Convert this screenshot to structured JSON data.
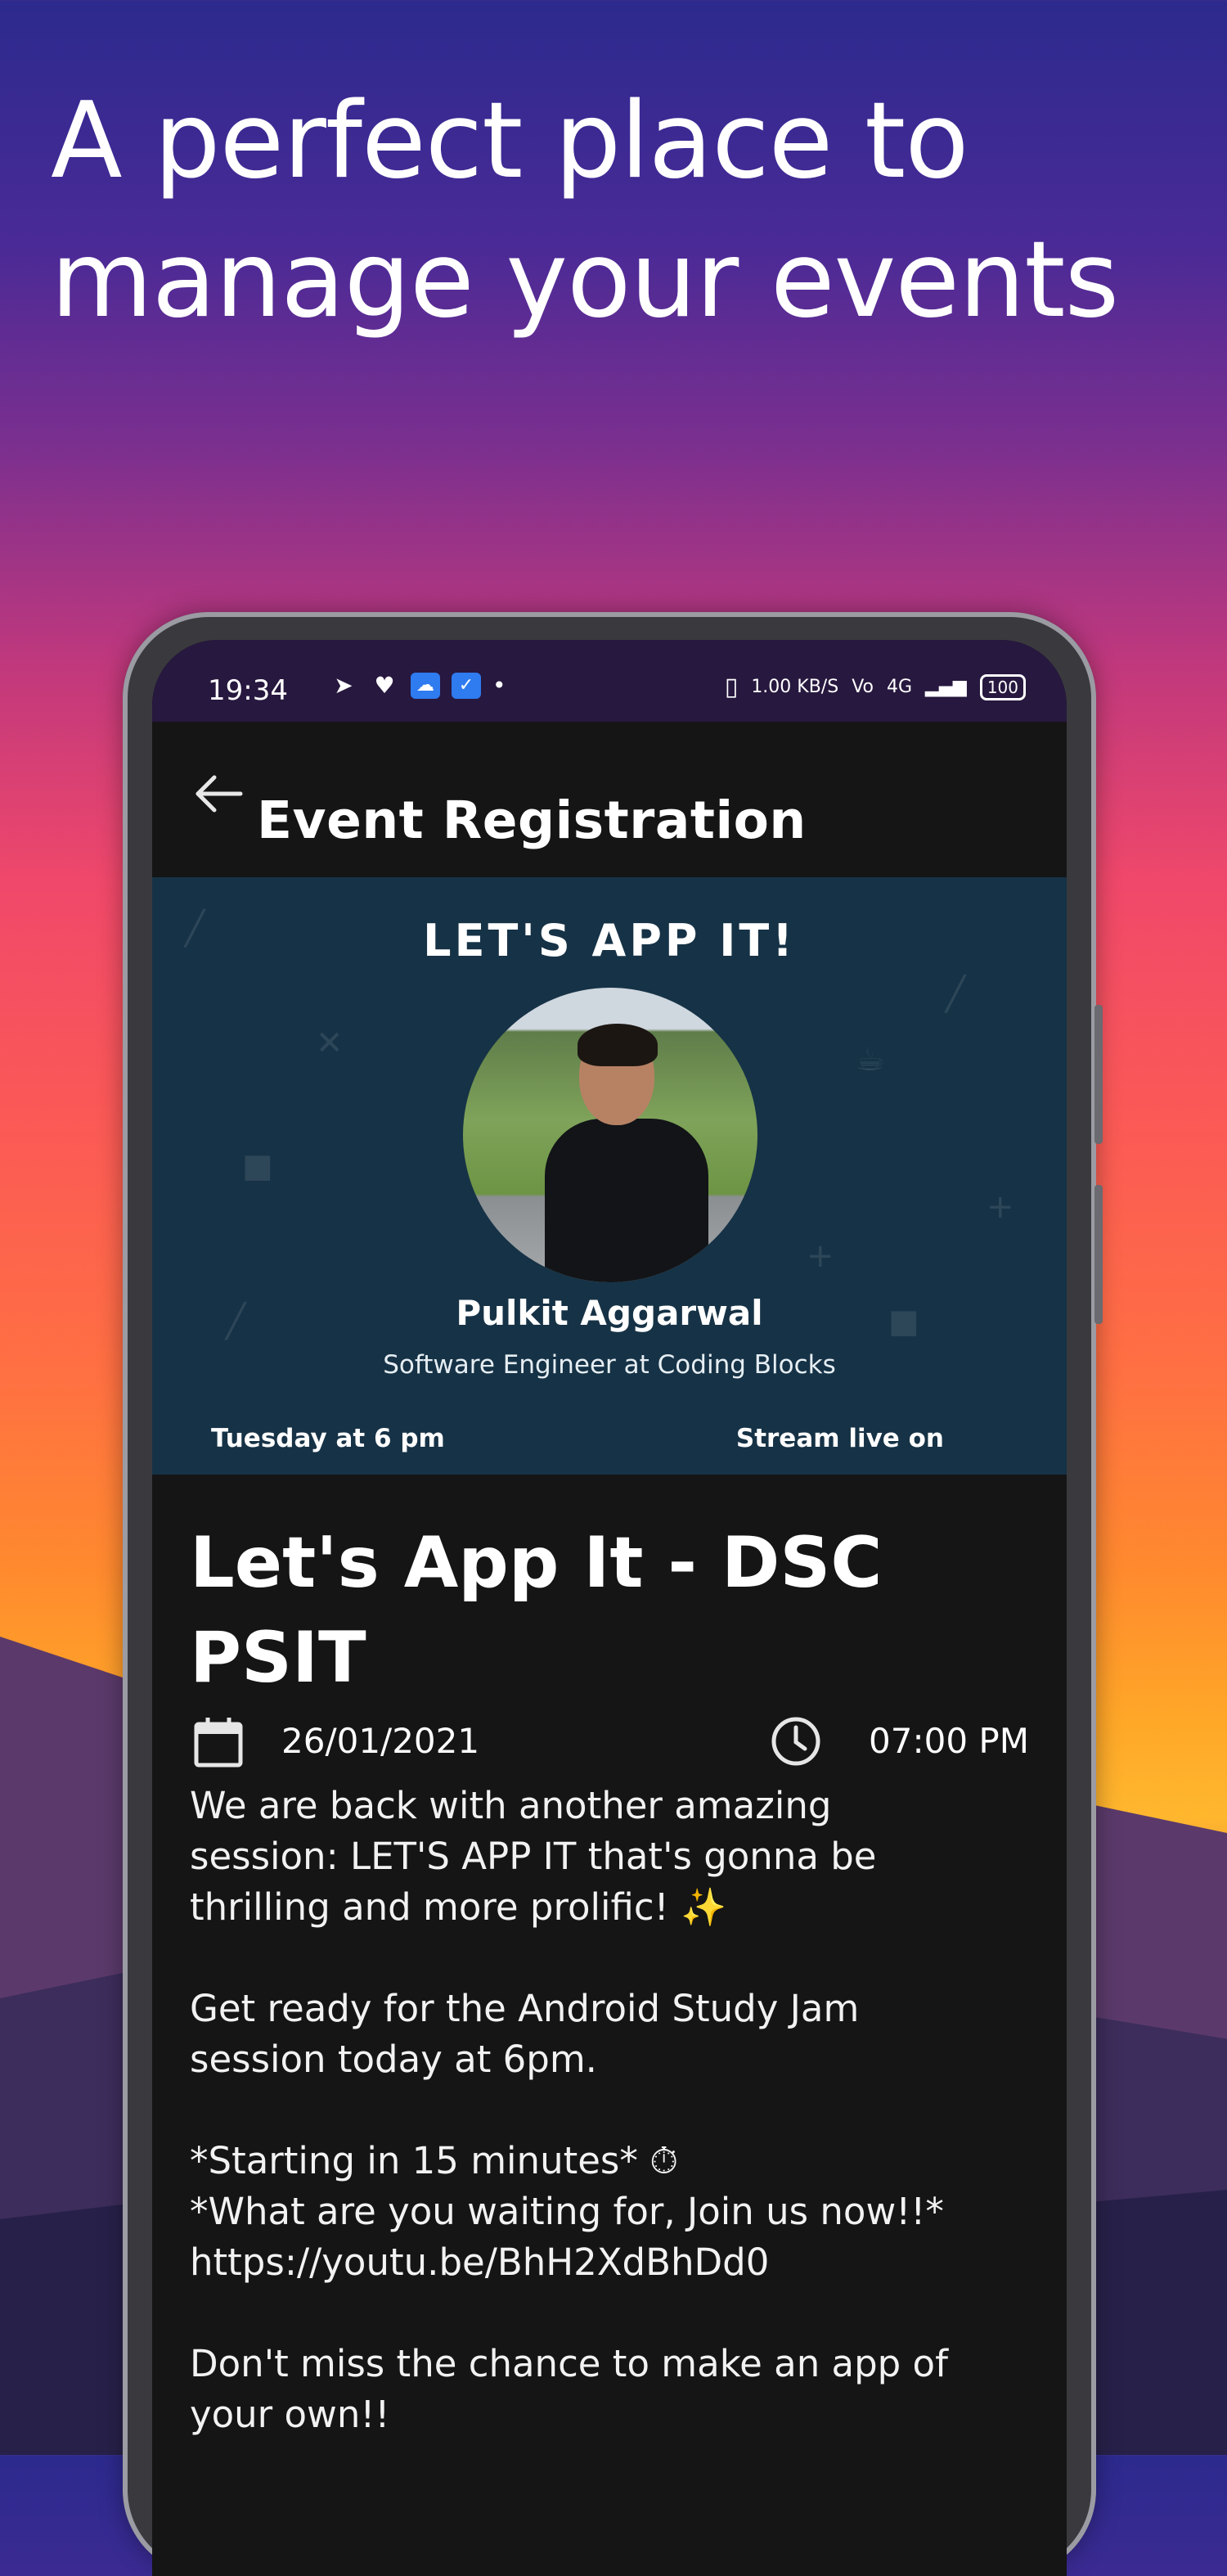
{
  "promo": {
    "headline_line1": "A perfect place to",
    "headline_line2": "manage your events"
  },
  "status_bar": {
    "time": "19:34",
    "network_speed": "1.00 KB/S",
    "signal": "4G",
    "battery": "100"
  },
  "app_bar": {
    "title": "Event Registration",
    "back_icon": "arrow-left-icon"
  },
  "banner": {
    "heading": "LET'S APP IT!",
    "speaker_name": "Pulkit Aggarwal",
    "speaker_role": "Software Engineer at Coding Blocks",
    "day": "Tuesday at 6 pm",
    "stream": "Stream live on"
  },
  "event": {
    "title_line1": "Let's App It - DSC",
    "title_line2": "PSIT",
    "date": "26/01/2021",
    "time": "07:00 PM",
    "desc_line1": "We are back with another amazing",
    "desc_line2": "session: LET'S APP IT that's gonna be",
    "desc_line3": "thrilling and more prolific! ✨",
    "desc_line4": "Get ready for  the Android Study Jam",
    "desc_line5": "session today at 6pm.",
    "desc_line6": "*Starting in 15 minutes* ⏱",
    "desc_line7": "*What are you waiting for, Join us now!!*",
    "desc_line8": "https://youtu.be/BhH2XdBhDd0",
    "desc_line9": "Don't miss the chance to make an app of",
    "desc_line10": "your own!!"
  },
  "colors": {
    "status_bar": "#27183f",
    "banner_bg": "#163246",
    "screen_bg": "#151515"
  }
}
